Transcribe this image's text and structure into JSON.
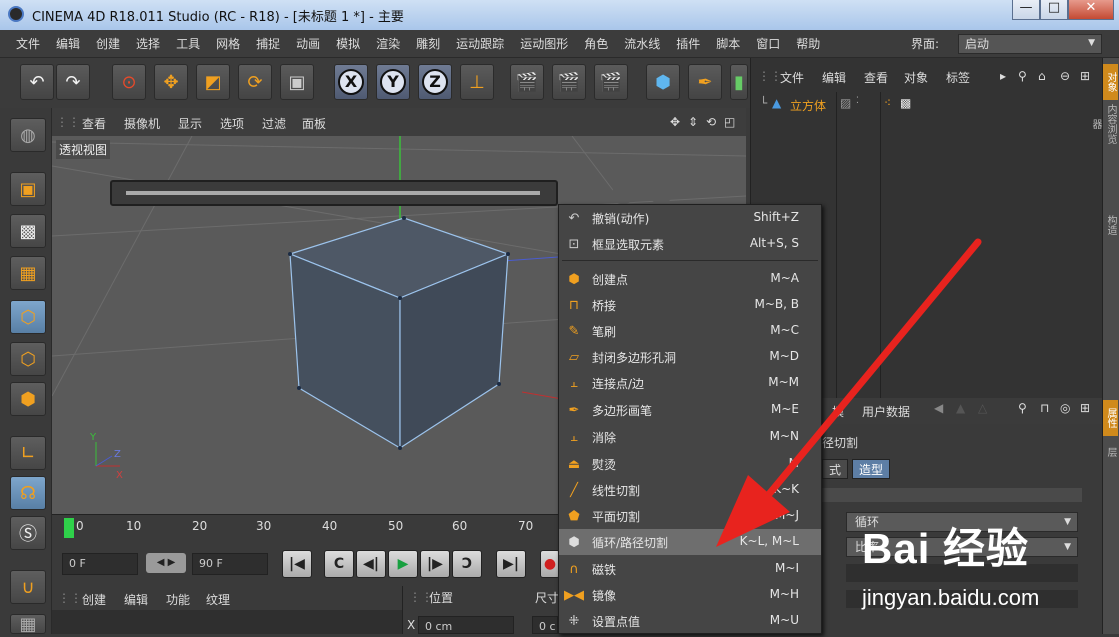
{
  "window": {
    "title": "CINEMA 4D R18.011 Studio (RC - R18) - [未标题 1 *] - 主要",
    "minimize": "—",
    "maximize": "□",
    "close": "✕"
  },
  "menubar": {
    "items": [
      "文件",
      "编辑",
      "创建",
      "选择",
      "工具",
      "网格",
      "捕捉",
      "动画",
      "模拟",
      "渲染",
      "雕刻",
      "运动跟踪",
      "运动图形",
      "角色",
      "流水线",
      "插件",
      "脚本",
      "窗口",
      "帮助"
    ],
    "interface_label": "界面:",
    "interface_value": "启动"
  },
  "viewport": {
    "menu": [
      "查看",
      "摄像机",
      "显示",
      "选项",
      "过滤",
      "面板"
    ],
    "label": "透视视图",
    "axis_x": "X",
    "axis_y": "Y",
    "axis_z": "Z"
  },
  "timeline": {
    "ticks": [
      "0",
      "10",
      "20",
      "30",
      "40",
      "50",
      "60",
      "70"
    ],
    "current_frame": "0 F",
    "end_frame": "90 F"
  },
  "material_panel": {
    "menu": [
      "创建",
      "编辑",
      "功能",
      "纹理"
    ]
  },
  "coord_panel": {
    "position_label": "位置",
    "size_label": "尺寸",
    "x_label": "X",
    "x_value": "0 cm",
    "x2_value": "0 c"
  },
  "object_manager": {
    "menu": [
      "文件",
      "编辑",
      "查看",
      "对象",
      "标签"
    ],
    "object_name": "立方体"
  },
  "attributes": {
    "user_data": "用户数据",
    "section_title": "径切割",
    "tab_mode": "式",
    "tab_modeling": "造型",
    "dropdown1": "循环",
    "dropdown2": "比率"
  },
  "right_tabs": [
    "对象",
    "内容浏览器",
    "构造",
    "属性",
    "层"
  ],
  "context_menu": {
    "groups": [
      [
        {
          "label": "撤销(动作)",
          "shortcut": "Shift+Z",
          "icon": "undo-icon"
        },
        {
          "label": "框显选取元素",
          "shortcut": "Alt+S, S",
          "icon": "frame-selection-icon"
        }
      ],
      [
        {
          "label": "创建点",
          "shortcut": "M~A",
          "icon": "create-point-icon"
        },
        {
          "label": "桥接",
          "shortcut": "M~B, B",
          "icon": "bridge-icon"
        },
        {
          "label": "笔刷",
          "shortcut": "M~C",
          "icon": "brush-icon"
        },
        {
          "label": "封闭多边形孔洞",
          "shortcut": "M~D",
          "icon": "close-hole-icon"
        },
        {
          "label": "连接点/边",
          "shortcut": "M~M",
          "icon": "connect-icon"
        },
        {
          "label": "多边形画笔",
          "shortcut": "M~E",
          "icon": "polygon-pen-icon"
        },
        {
          "label": "消除",
          "shortcut": "M~N",
          "icon": "dissolve-icon"
        },
        {
          "label": "熨烫",
          "shortcut": "M",
          "icon": "iron-icon"
        },
        {
          "label": "线性切割",
          "shortcut": "K~K",
          "icon": "line-cut-icon"
        },
        {
          "label": "平面切割",
          "shortcut": "M~J",
          "icon": "plane-cut-icon"
        },
        {
          "label": "循环/路径切割",
          "shortcut": "K~L, M~L",
          "icon": "loop-cut-icon",
          "highlighted": true
        },
        {
          "label": "磁铁",
          "shortcut": "M~I",
          "icon": "magnet-icon"
        },
        {
          "label": "镜像",
          "shortcut": "M~H",
          "icon": "mirror-icon"
        },
        {
          "label": "设置点值",
          "shortcut": "M~U",
          "icon": "set-point-value-icon"
        }
      ]
    ]
  },
  "watermark": {
    "brand": "Bai 经验",
    "url": "jingyan.baidu.com"
  },
  "colors": {
    "accent_orange": "#f0a020",
    "selection_blue": "#5d7ea5",
    "annotation_red": "#e8231e"
  }
}
